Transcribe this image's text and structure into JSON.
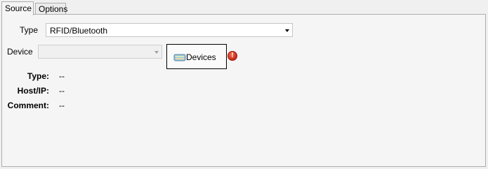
{
  "tabs": [
    {
      "label": "Source",
      "active": true
    },
    {
      "label": "Options",
      "active": false
    }
  ],
  "source": {
    "type_label": "Type",
    "type_value": "RFID/Bluetooth",
    "device_label": "Device",
    "device_value": "",
    "devices_button_label": "Devices",
    "error_icon": "!",
    "info": {
      "type_label": "Type:",
      "type_value": "--",
      "host_label": "Host/IP:",
      "host_value": "--",
      "comment_label": "Comment:",
      "comment_value": "--"
    }
  },
  "icons": {
    "devices_button_icon": "devices-icon",
    "warning": "error-icon"
  },
  "colors": {
    "error_red": "#c8281a",
    "window_bg": "#f0f0f0"
  }
}
